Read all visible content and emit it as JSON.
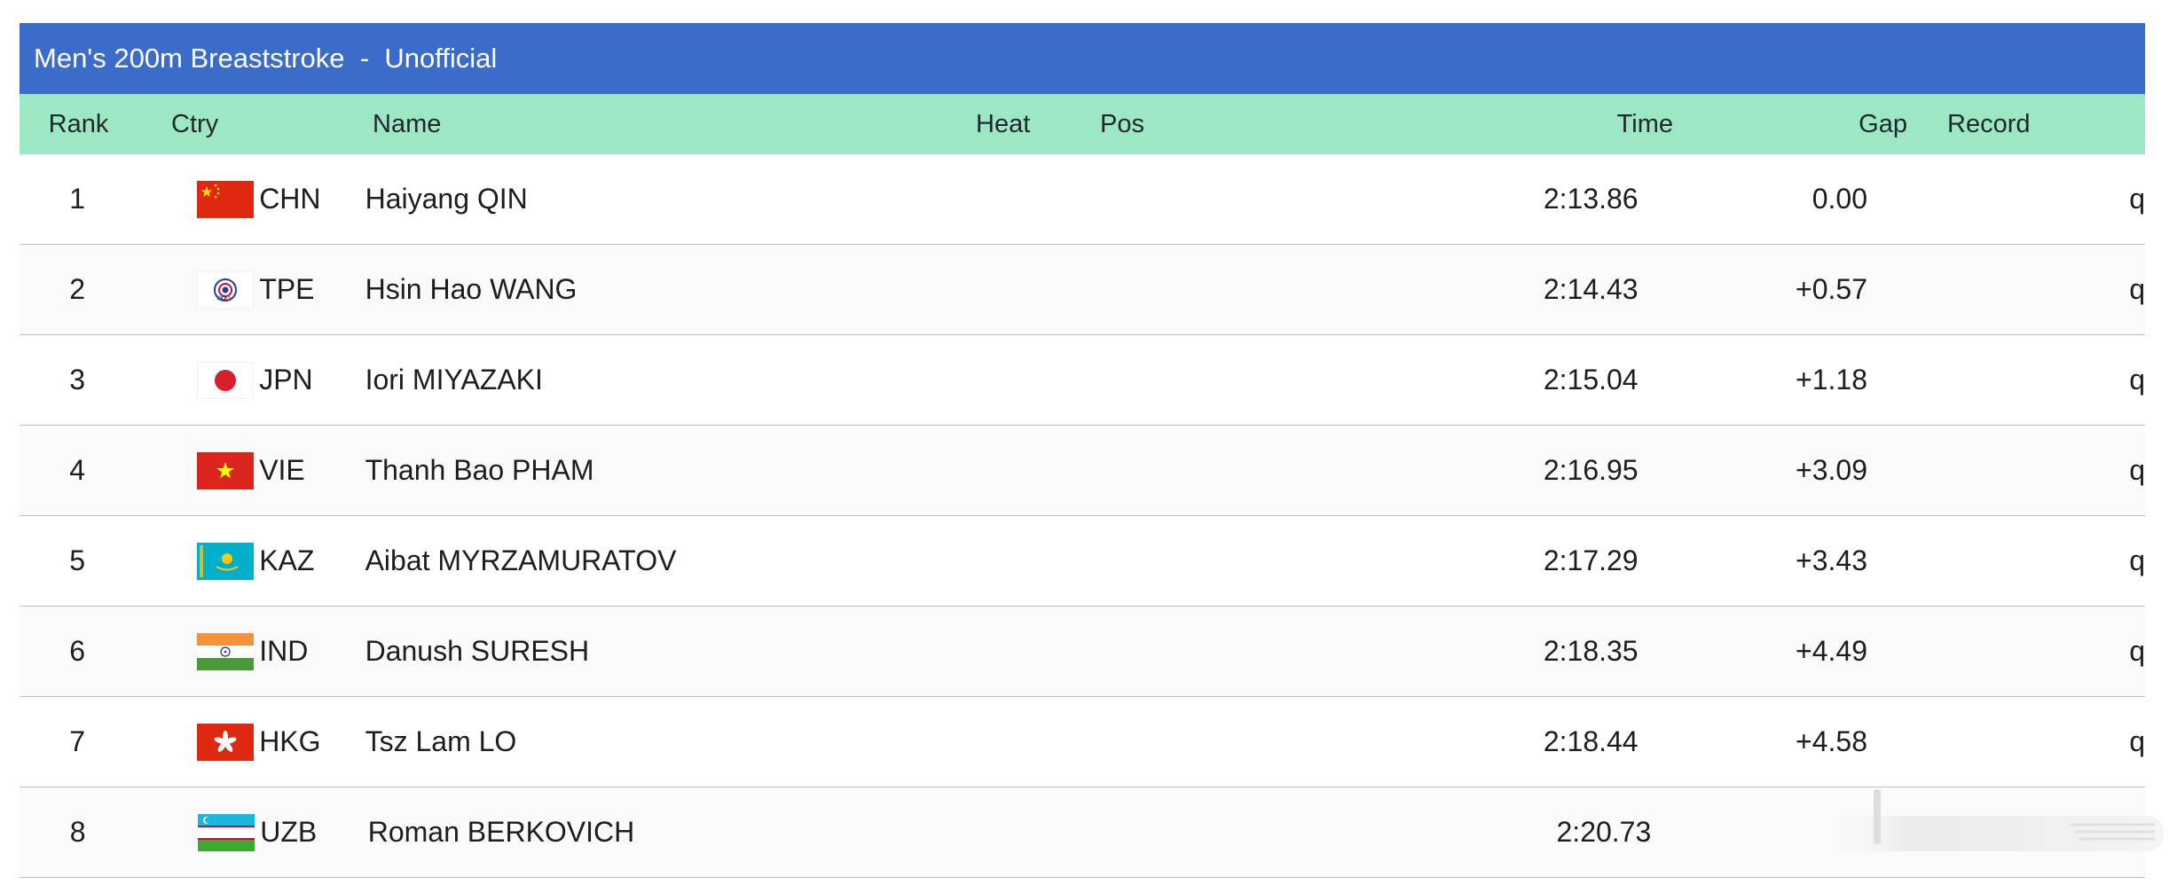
{
  "title": {
    "event": "Men's 200m Breaststroke",
    "separator": "-",
    "status": "Unofficial"
  },
  "columns": {
    "rank": "Rank",
    "ctry": "Ctry",
    "name": "Name",
    "heat": "Heat",
    "pos": "Pos",
    "time": "Time",
    "gap": "Gap",
    "record": "Record"
  },
  "rows": [
    {
      "rank": "1",
      "ctry": "CHN",
      "flag": "china-flag-icon",
      "name": "Haiyang QIN",
      "time": "2:13.86",
      "gap": "0.00",
      "q": "q"
    },
    {
      "rank": "2",
      "ctry": "TPE",
      "flag": "chinese-taipei-flag-icon",
      "name": "Hsin Hao WANG",
      "time": "2:14.43",
      "gap": "+0.57",
      "q": "q"
    },
    {
      "rank": "3",
      "ctry": "JPN",
      "flag": "japan-flag-icon",
      "name": "Iori MIYAZAKI",
      "time": "2:15.04",
      "gap": "+1.18",
      "q": "q"
    },
    {
      "rank": "4",
      "ctry": "VIE",
      "flag": "vietnam-flag-icon",
      "name": "Thanh Bao PHAM",
      "time": "2:16.95",
      "gap": "+3.09",
      "q": "q"
    },
    {
      "rank": "5",
      "ctry": "KAZ",
      "flag": "kazakhstan-flag-icon",
      "name": "Aibat MYRZAMURATOV",
      "time": "2:17.29",
      "gap": "+3.43",
      "q": "q"
    },
    {
      "rank": "6",
      "ctry": "IND",
      "flag": "india-flag-icon",
      "name": "Danush SURESH",
      "time": "2:18.35",
      "gap": "+4.49",
      "q": "q"
    },
    {
      "rank": "7",
      "ctry": "HKG",
      "flag": "hong-kong-flag-icon",
      "name": "Tsz Lam LO",
      "time": "2:18.44",
      "gap": "+4.58",
      "q": "q"
    },
    {
      "rank": "8",
      "ctry": "UZB",
      "flag": "uzbekistan-flag-icon",
      "name": "Roman BERKOVICH",
      "time": "2:20.73",
      "gap": "",
      "q": ""
    }
  ],
  "colors": {
    "title_bg": "#3b6cc9",
    "header_bg": "#9de8c4",
    "row_divider": "#bfbfbf"
  }
}
